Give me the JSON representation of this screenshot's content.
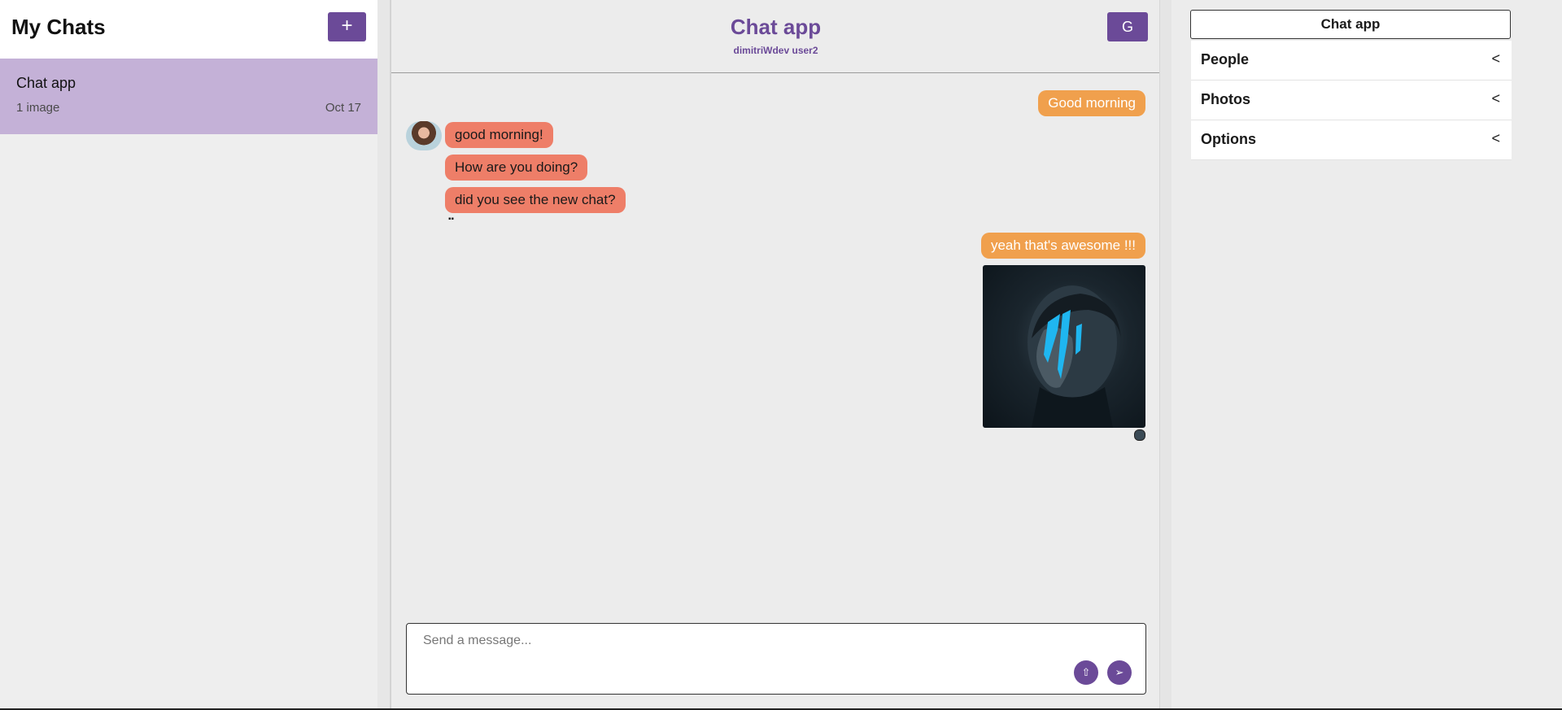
{
  "sidebar": {
    "title": "My Chats",
    "add_button": "+",
    "chats": [
      {
        "name": "Chat app",
        "preview": "1 image",
        "date": "Oct 17"
      }
    ]
  },
  "chat": {
    "title": "Chat app",
    "users": "dimitriWdev user2",
    "refresh_icon": "G",
    "messages": [
      {
        "text": "Good morning",
        "direction": "out"
      },
      {
        "text": "good morning!",
        "direction": "in"
      },
      {
        "text": "How are you doing?",
        "direction": "in"
      },
      {
        "text": "did you see the new chat?",
        "direction": "in"
      },
      {
        "text": "yeah that's awesome !!!",
        "direction": "out"
      }
    ],
    "image_message": {
      "alt": "Man with blue face paint"
    },
    "composer": {
      "placeholder": "Send a message...",
      "upload_icon": "⇧",
      "send_icon": "➢"
    }
  },
  "details": {
    "title": "Chat app",
    "sections": [
      {
        "label": "People",
        "chevron": "<"
      },
      {
        "label": "Photos",
        "chevron": "<"
      },
      {
        "label": "Options",
        "chevron": "<"
      }
    ]
  },
  "colors": {
    "accent": "#6b4a98",
    "selected_chat": "#c4b1d7",
    "outgoing_bubble": "#f0a04d",
    "incoming_bubble": "#ee7e68",
    "background": "#ececec"
  }
}
